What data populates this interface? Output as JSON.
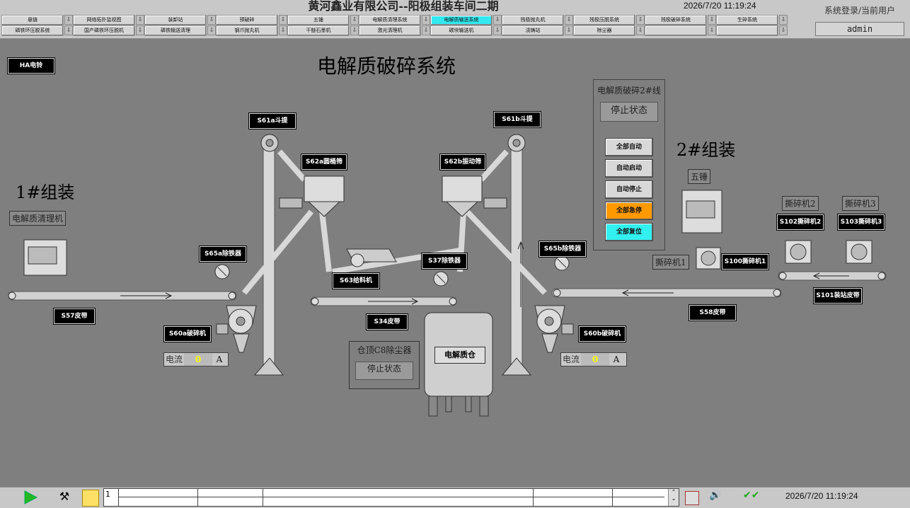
{
  "header": {
    "title": "黄河鑫业有限公司--阳极组装车间二期",
    "datetime": "2026/7/20 11:19:24",
    "login_label": "系统登录/当前用户",
    "user": "admin"
  },
  "nav": {
    "row1": [
      "悬链",
      "网络拓扑监视图",
      "装卸站",
      "预破碎",
      "五锤",
      "电解质清理系统",
      "电解质输送系统",
      "残极抛丸机",
      "残极压脱系统",
      "残极破碎系统",
      "生碎系统"
    ],
    "row2": [
      "磷铁环压脱系统",
      "国产磷铁环压脱机",
      "磷铁输送清理",
      "钢爪抛丸机",
      "干醚石墨机",
      "激光清理机",
      "碳块输送机",
      "浇铸站",
      "除尘器",
      "",
      ""
    ],
    "active": "电解质输送系统"
  },
  "page_title": "电解质破碎系统",
  "alarm_button": "HA电铃",
  "control_panel": {
    "title": "电解质破碎2#线",
    "status": "停止状态",
    "buttons": [
      "全部自动",
      "自动启动",
      "自动停止",
      "全部急停",
      "全部复位"
    ],
    "button_colors": [
      "#d8d8d8",
      "#d8d8d8",
      "#d8d8d8",
      "#ff9900",
      "#33f0f0"
    ]
  },
  "equipment": {
    "line1": "1#组装",
    "line2": "2#组装",
    "cleaner": "电解质清理机",
    "s61a": "S61a斗提",
    "s61b": "S61b斗提",
    "s62a": "S62a圆桶筛",
    "s62b": "S62b振动筛",
    "s65a": "S65a除铁器",
    "s65b": "S65b除铁器",
    "s63": "S63给料机",
    "s37": "S37除铁器",
    "s57": "S57皮带",
    "s34": "S34皮带",
    "s58": "S58皮带",
    "s60a": "S60a破碎机",
    "s60b": "S60b破碎机",
    "s100": "S100撕碎机1",
    "s101": "S101装站皮带",
    "s102": "S102撕碎机2",
    "s103": "S103撕碎机3",
    "shredder1": "撕碎机1",
    "shredder2": "撕碎机2",
    "shredder3": "撕碎机3",
    "five_hammer": "五锤",
    "silo": "电解质仓",
    "dust_title": "仓顶C8除尘器",
    "dust_status": "停止状态"
  },
  "meters": {
    "label": "电流",
    "unit": "A",
    "left_value": "0",
    "right_value": "0"
  },
  "footer": {
    "datetime": "2026/7/20 11:19:24",
    "table_value": "1"
  }
}
